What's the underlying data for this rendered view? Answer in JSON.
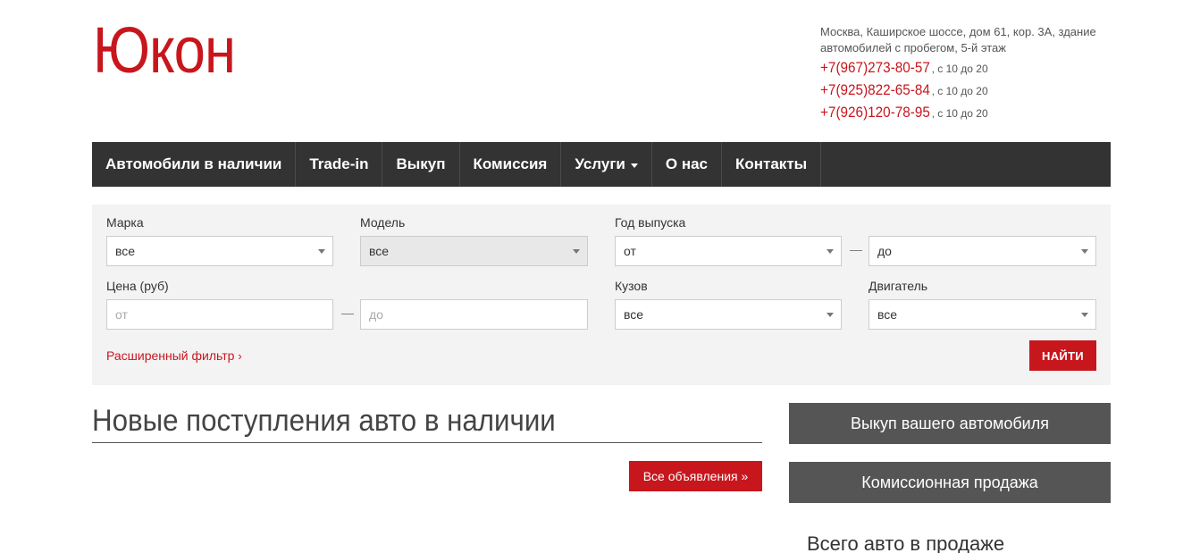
{
  "header": {
    "logo": "Юкон",
    "address": "Москва, Каширское шоссе, дом 61, кор. 3А, здание автомобилей с пробегом, 5-й этаж",
    "phones": [
      {
        "number": "+7(967)273-80-57",
        "hours": ", с 10 до 20"
      },
      {
        "number": "+7(925)822-65-84",
        "hours": ", с 10 до 20"
      },
      {
        "number": "+7(926)120-78-95",
        "hours": ", с 10 до 20"
      }
    ]
  },
  "nav": {
    "items": [
      "Автомобили в наличии",
      "Trade-in",
      "Выкуп",
      "Комиссия",
      "Услуги",
      "О нас",
      "Контакты"
    ]
  },
  "filter": {
    "brand": {
      "label": "Марка",
      "value": "все"
    },
    "model": {
      "label": "Модель",
      "value": "все"
    },
    "year": {
      "label": "Год выпуска",
      "from": "от",
      "to": "до"
    },
    "price": {
      "label": "Цена (руб)",
      "from_placeholder": "от",
      "to_placeholder": "до"
    },
    "body": {
      "label": "Кузов",
      "value": "все"
    },
    "engine": {
      "label": "Двигатель",
      "value": "все"
    },
    "dash": "—",
    "advanced_link": "Расширенный фильтр",
    "search_button": "НАЙТИ"
  },
  "main": {
    "title": "Новые поступления авто в наличии",
    "all_ads_button": "Все объявления »"
  },
  "sidebar": {
    "buyout_button": "Выкуп вашего автомобиля",
    "commission_button": "Комиссионная продажа",
    "total_heading": "Всего авто в продаже"
  },
  "colors": {
    "accent": "#c8161d",
    "nav_bg": "#333333",
    "side_button_bg": "#555555"
  }
}
